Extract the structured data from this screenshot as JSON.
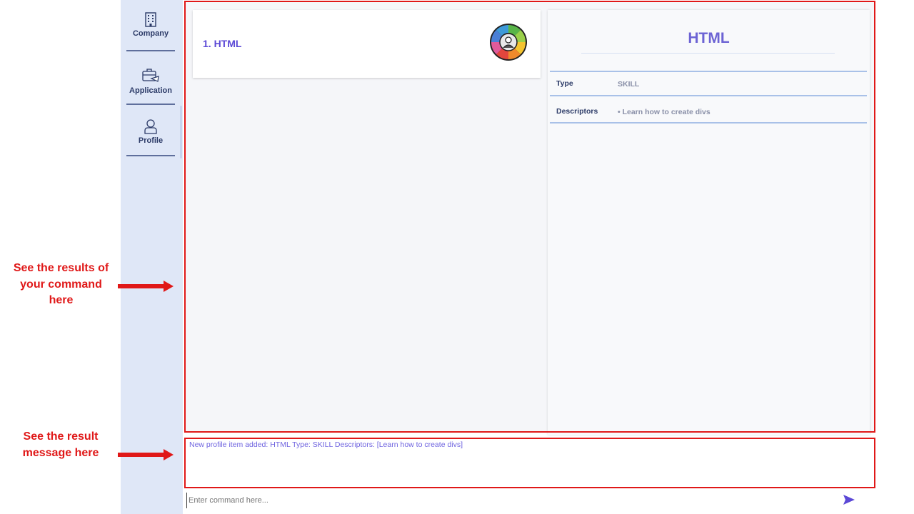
{
  "sidebar": {
    "items": [
      {
        "label": "Company",
        "icon": "building-icon"
      },
      {
        "label": "Application",
        "icon": "briefcase-icon"
      },
      {
        "label": "Profile",
        "icon": "person-icon"
      }
    ]
  },
  "list": {
    "items": [
      {
        "label": "1.  HTML",
        "icon": "profile-avatar-icon"
      }
    ]
  },
  "detail": {
    "title": "HTML",
    "rows": [
      {
        "label": "Type",
        "value": "SKILL"
      },
      {
        "label": "Descriptors",
        "value": "• Learn how to create divs"
      }
    ]
  },
  "result": {
    "message": "New profile item added: HTML Type: SKILL Descriptors: [Learn how to create divs]"
  },
  "command": {
    "placeholder": "Enter command here...",
    "send_icon": "send-icon"
  },
  "annotations": {
    "results_note": "See the results of your command here",
    "message_note": "See the result message here"
  },
  "colors": {
    "accent": "#5b48d6",
    "sidebar": "#dfe7f7",
    "annotation": "#e01818"
  }
}
